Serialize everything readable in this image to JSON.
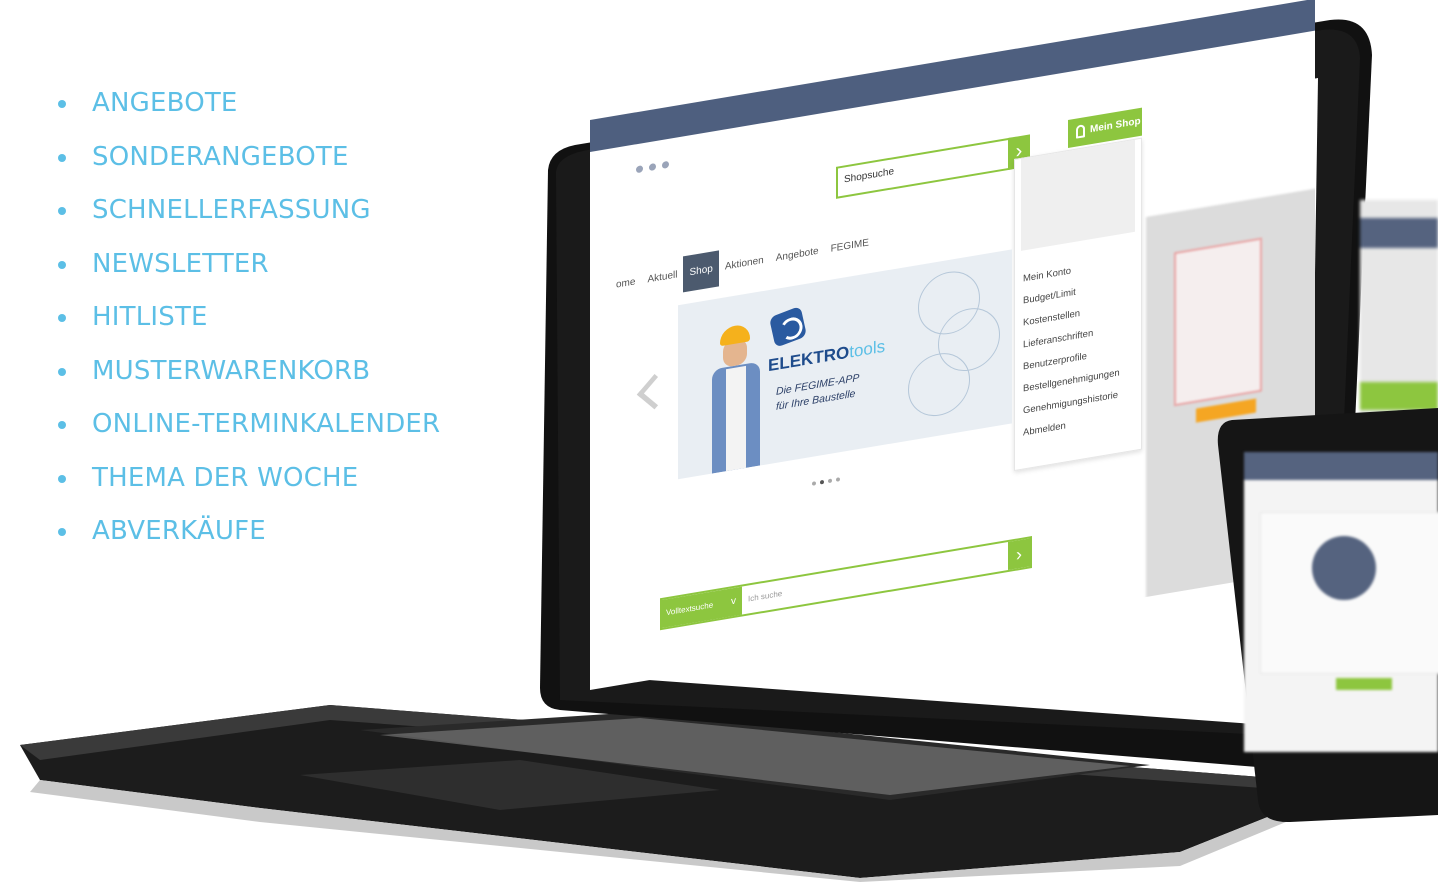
{
  "features": [
    "ANGEBOTE",
    "SONDERANGEBOTE",
    "SCHNELLERFASSUNG",
    "NEWSLETTER",
    "HITLISTE",
    "MUSTERWARENKORB",
    "ONLINE-TERMINKALENDER",
    "THEMA DER WOCHE",
    "ABVERKÄUFE"
  ],
  "shop": {
    "nav": [
      "ome",
      "Aktuell",
      "Shop",
      "Aktionen",
      "Angebote",
      "FEGIME"
    ],
    "active_nav": "Shop",
    "search_placeholder": "Shopsuche",
    "mein_shop_label": "Mein Shop",
    "account_menu": [
      "Mein Konto",
      "Budget/Limit",
      "Kostenstellen",
      "Lieferanschriften",
      "Benutzerprofile",
      "Bestellgenehmigungen",
      "Genehmigungshistorie",
      "Abmelden"
    ],
    "banner": {
      "brand_bold": "ELEKTRO",
      "brand_thin": "tools",
      "tagline_1": "Die FEGIME-APP",
      "tagline_2": "für Ihre Baustelle"
    },
    "bottom_search": {
      "select_label": "Volltextsuche",
      "placeholder": "Ich suche"
    }
  },
  "colors": {
    "accent": "#5cbfe6",
    "green": "#8dc63f",
    "navbar": "#4e5f7f"
  }
}
